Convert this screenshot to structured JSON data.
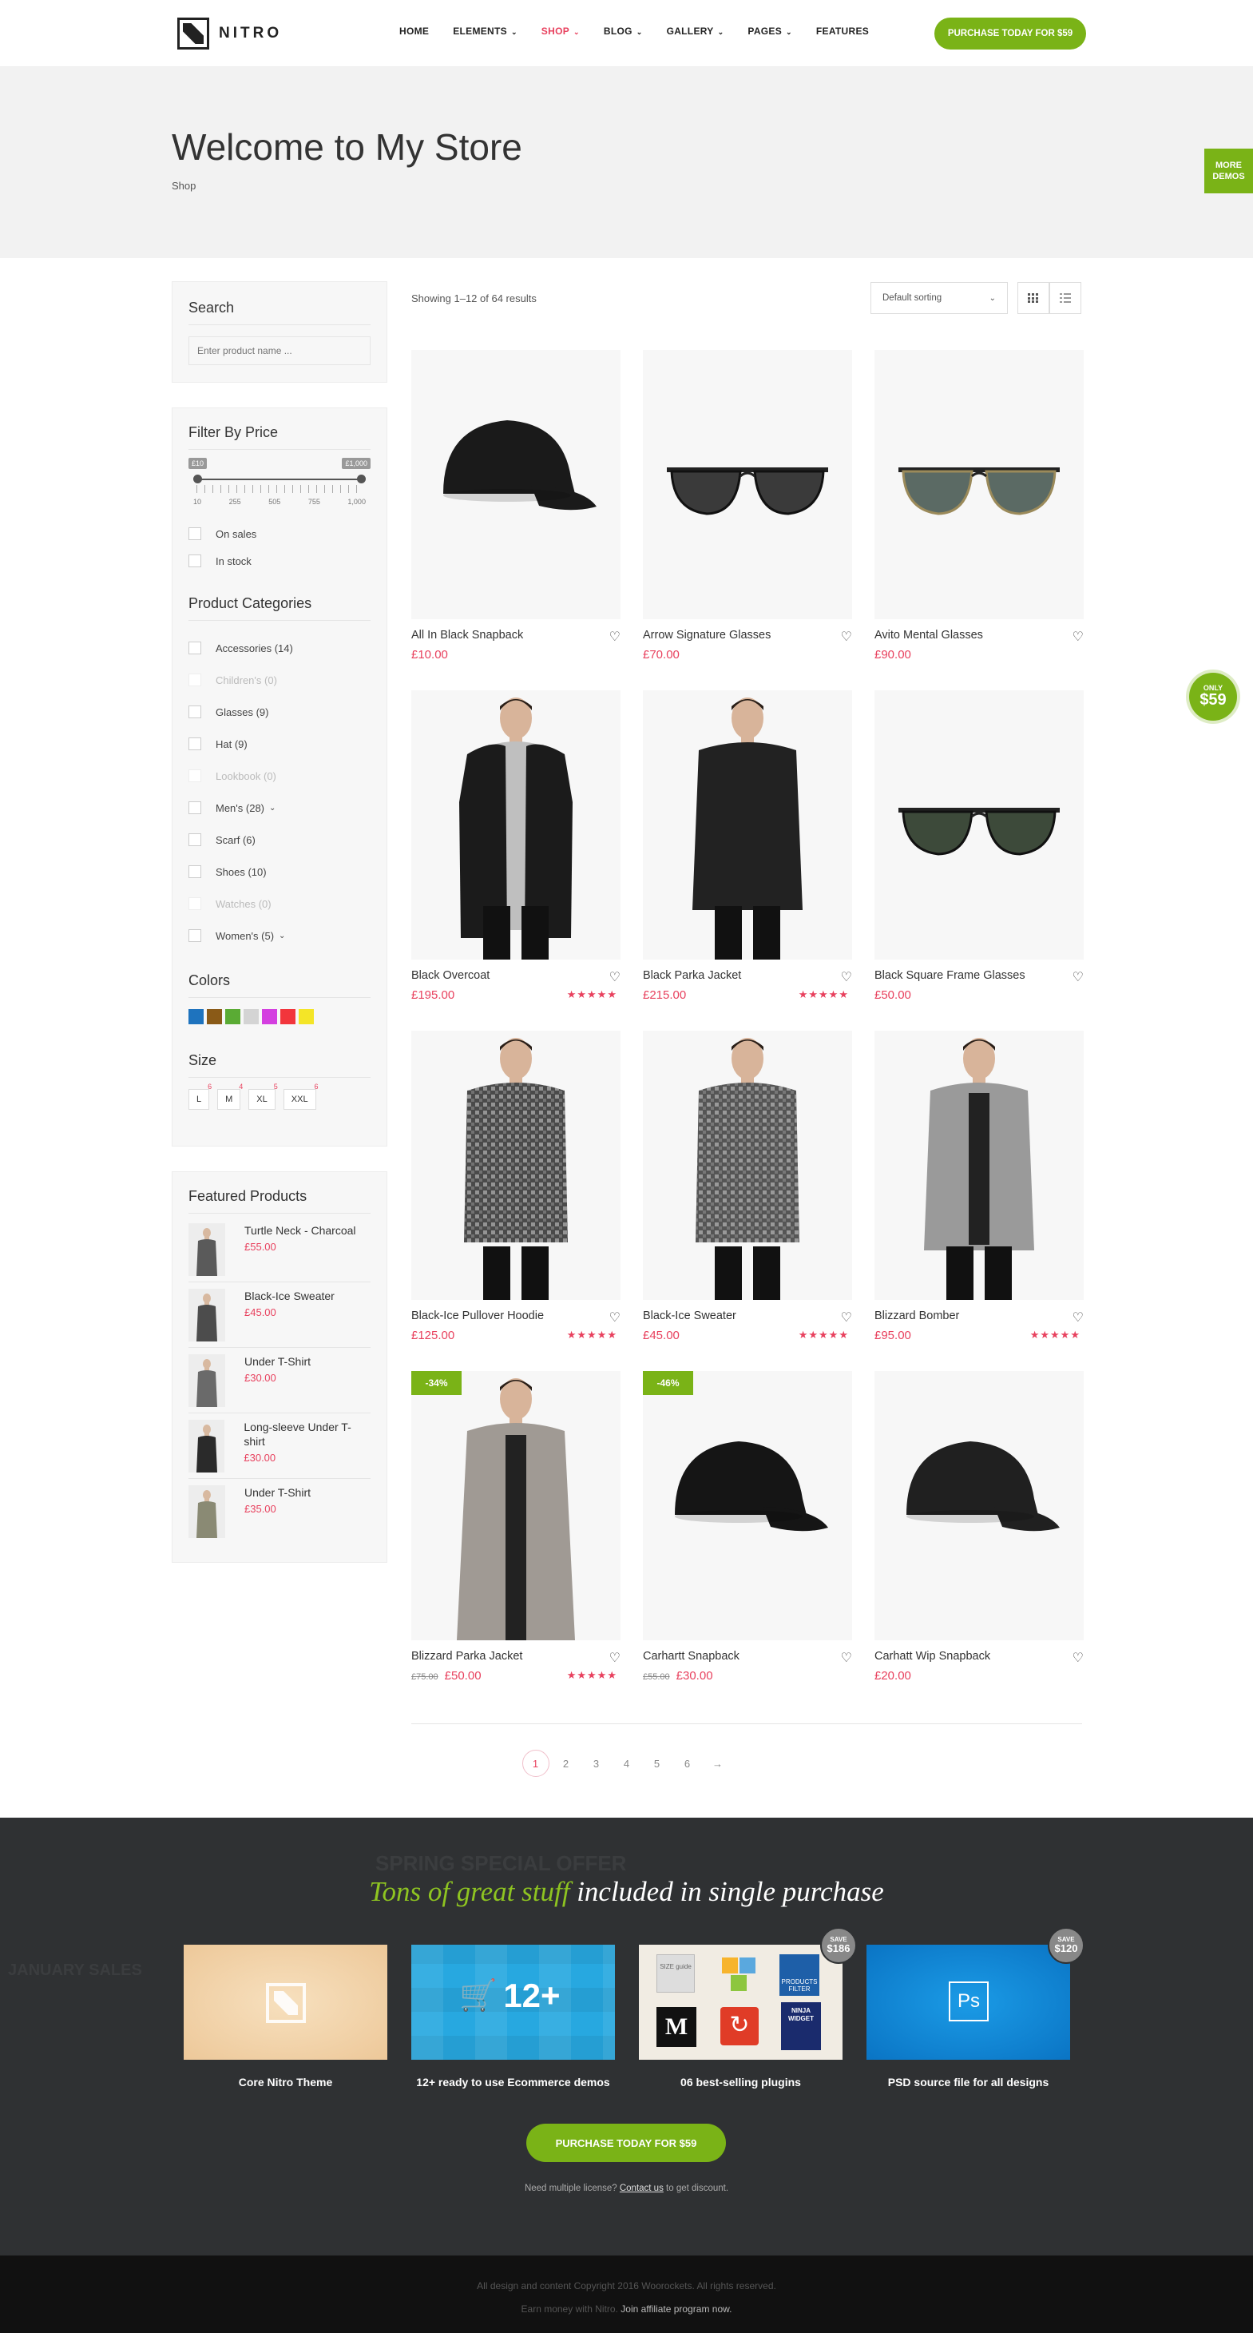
{
  "header": {
    "logo_text": "NITRO",
    "nav": [
      {
        "label": "HOME",
        "dropdown": false,
        "active": false
      },
      {
        "label": "ELEMENTS",
        "dropdown": true,
        "active": false
      },
      {
        "label": "SHOP",
        "dropdown": true,
        "active": true
      },
      {
        "label": "BLOG",
        "dropdown": true,
        "active": false
      },
      {
        "label": "GALLERY",
        "dropdown": true,
        "active": false
      },
      {
        "label": "PAGES",
        "dropdown": true,
        "active": false
      },
      {
        "label": "FEATURES",
        "dropdown": false,
        "active": false
      }
    ],
    "cta": "PURCHASE TODAY FOR $59"
  },
  "hero": {
    "title": "Welcome to My Store",
    "breadcrumb": "Shop"
  },
  "side_tabs": {
    "more_demos_1": "MORE",
    "more_demos_2": "DEMOS",
    "only_1": "ONLY",
    "only_2": "$59"
  },
  "sidebar": {
    "search": {
      "title": "Search",
      "placeholder": "Enter product name ..."
    },
    "price": {
      "title": "Filter By Price",
      "min_tag": "£10",
      "max_tag": "£1,000",
      "scale": [
        "10",
        "255",
        "505",
        "755",
        "1,000"
      ],
      "filters": [
        "On sales",
        "In stock"
      ]
    },
    "categories": {
      "title": "Product Categories",
      "items": [
        {
          "label": "Accessories (14)",
          "dim": false,
          "expand": false
        },
        {
          "label": "Children's (0)",
          "dim": true,
          "expand": false
        },
        {
          "label": "Glasses (9)",
          "dim": false,
          "expand": false
        },
        {
          "label": "Hat (9)",
          "dim": false,
          "expand": false
        },
        {
          "label": "Lookbook (0)",
          "dim": true,
          "expand": false
        },
        {
          "label": "Men's (28)",
          "dim": false,
          "expand": true
        },
        {
          "label": "Scarf (6)",
          "dim": false,
          "expand": false
        },
        {
          "label": "Shoes (10)",
          "dim": false,
          "expand": false
        },
        {
          "label": "Watches (0)",
          "dim": true,
          "expand": false
        },
        {
          "label": "Women's (5)",
          "dim": false,
          "expand": true
        }
      ]
    },
    "colors": {
      "title": "Colors",
      "swatches": [
        "#1e73be",
        "#8a5a17",
        "#5aab34",
        "#d4d4d4",
        "#d43fe0",
        "#f2353c",
        "#f4e527"
      ]
    },
    "sizes": {
      "title": "Size",
      "items": [
        {
          "label": "L",
          "count": "6"
        },
        {
          "label": "M",
          "count": "4"
        },
        {
          "label": "XL",
          "count": "5"
        },
        {
          "label": "XXL",
          "count": "6"
        }
      ]
    },
    "featured": {
      "title": "Featured Products",
      "items": [
        {
          "name": "Turtle Neck - Charcoal",
          "price": "£55.00",
          "tone": "#5a5a5a"
        },
        {
          "name": "Black-Ice Sweater",
          "price": "£45.00",
          "tone": "#4c4c4c"
        },
        {
          "name": "Under T-Shirt",
          "price": "£30.00",
          "tone": "#6a6a6a"
        },
        {
          "name": "Long-sleeve Under T-shirt",
          "price": "£30.00",
          "tone": "#2a2a2a"
        },
        {
          "name": "Under T-Shirt",
          "price": "£35.00",
          "tone": "#8a8a74"
        }
      ]
    }
  },
  "toolbar": {
    "result_count": "Showing 1–12 of 64 results",
    "sort": "Default sorting"
  },
  "products": [
    {
      "name": "All In Black Snapback",
      "price": "£10.00",
      "old": "",
      "rating": "",
      "badge": "",
      "kind": "cap",
      "tone": "#1a1a1a"
    },
    {
      "name": "Arrow Signature Glasses",
      "price": "£70.00",
      "old": "",
      "rating": "",
      "badge": "",
      "kind": "glasses",
      "tone": "#2a2a2a"
    },
    {
      "name": "Avito Mental Glasses",
      "price": "£90.00",
      "old": "",
      "rating": "",
      "badge": "",
      "kind": "aviator",
      "tone": "#6e7b74"
    },
    {
      "name": "Black Overcoat",
      "price": "£195.00",
      "old": "",
      "rating": "5",
      "badge": "",
      "kind": "coat",
      "tone": "#1b1b1b"
    },
    {
      "name": "Black Parka Jacket",
      "price": "£215.00",
      "old": "",
      "rating": "5",
      "badge": "",
      "kind": "parka",
      "tone": "#222"
    },
    {
      "name": "Black Square Frame Glasses",
      "price": "£50.00",
      "old": "",
      "rating": "",
      "badge": "",
      "kind": "glasses",
      "tone": "#23291f"
    },
    {
      "name": "Black-Ice Pullover Hoodie",
      "price": "£125.00",
      "old": "",
      "rating": "5",
      "badge": "",
      "kind": "hoodie",
      "tone": "#4a4a4a"
    },
    {
      "name": "Black-Ice Sweater",
      "price": "£45.00",
      "old": "",
      "rating": "5",
      "badge": "",
      "kind": "sweater",
      "tone": "#555"
    },
    {
      "name": "Blizzard Bomber",
      "price": "£95.00",
      "old": "",
      "rating": "5",
      "badge": "",
      "kind": "bomber",
      "tone": "#9a9a9a"
    },
    {
      "name": "Blizzard Parka Jacket",
      "price": "£50.00",
      "old": "£75.00",
      "rating": "5",
      "badge": "-34%",
      "kind": "longparka",
      "tone": "#a09a94"
    },
    {
      "name": "Carhartt Snapback",
      "price": "£30.00",
      "old": "£55.00",
      "rating": "",
      "badge": "-46%",
      "kind": "cap",
      "tone": "#151515"
    },
    {
      "name": "Carhatt Wip Snapback",
      "price": "£20.00",
      "old": "",
      "rating": "",
      "badge": "",
      "kind": "cap",
      "tone": "#202020"
    }
  ],
  "pagination": [
    "1",
    "2",
    "3",
    "4",
    "5",
    "6",
    "→"
  ],
  "promo": {
    "title_green": "Tons of great stuff",
    "title_rest": " included in single purchase",
    "ghost_1": "SPRING SPECIAL OFFER",
    "ghost_2": "JANUARY SALES",
    "cards": [
      {
        "label": "Core Nitro Theme",
        "save_1": "",
        "save_2": ""
      },
      {
        "label": "12+ ready to use Ecommerce demos",
        "save_1": "",
        "save_2": "",
        "big": "12+"
      },
      {
        "label": "06 best-selling plugins",
        "save_1": "SAVE",
        "save_2": "$186"
      },
      {
        "label": "PSD source file for all designs",
        "save_1": "SAVE",
        "save_2": "$120"
      }
    ],
    "plugin_texts": {
      "size_guide": "SIZE guide",
      "products_filter": "PRODUCTS FILTER",
      "ninja": "NINJA WIDGET",
      "m": "M"
    },
    "ps": "Ps",
    "cta": "PURCHASE TODAY FOR $59",
    "note": "Need multiple license?",
    "note_link": "Contact us",
    "note_end": " to get discount."
  },
  "footer": {
    "copyright": "All design and content Copyright 2016 Woorockets. All rights reserved.",
    "earn": "Earn money with Nitro.",
    "affiliate": "Join affiliate program now."
  }
}
